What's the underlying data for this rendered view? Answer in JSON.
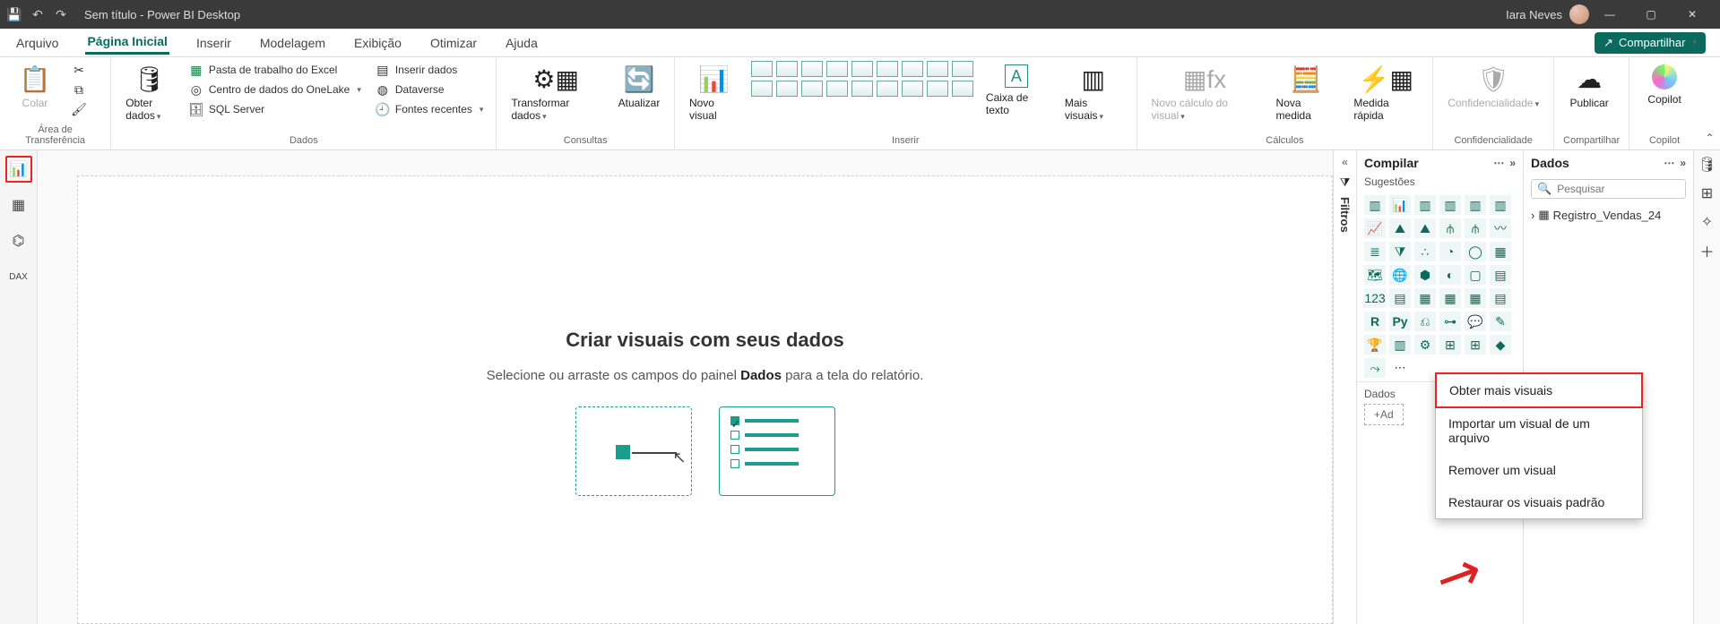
{
  "titlebar": {
    "title": "Sem título - Power BI Desktop",
    "user": "Iara Neves"
  },
  "menu": {
    "tabs": [
      "Arquivo",
      "Página Inicial",
      "Inserir",
      "Modelagem",
      "Exibição",
      "Otimizar",
      "Ajuda"
    ],
    "active": 1,
    "share": "Compartilhar"
  },
  "ribbon": {
    "clipboard": {
      "paste": "Colar",
      "group": "Área de Transferência"
    },
    "data": {
      "get": "Obter dados",
      "excel": "Pasta de trabalho do Excel",
      "onelake": "Centro de dados do OneLake",
      "sql": "SQL Server",
      "enter": "Inserir dados",
      "dataverse": "Dataverse",
      "recent": "Fontes recentes",
      "group": "Dados"
    },
    "queries": {
      "transform": "Transformar dados",
      "refresh": "Atualizar",
      "group": "Consultas"
    },
    "insert": {
      "newvis": "Novo visual",
      "textbox": "Caixa de texto",
      "more": "Mais visuais",
      "group": "Inserir"
    },
    "calc": {
      "newcalc": "Novo cálculo do visual",
      "newmeasure": "Nova medida",
      "quick": "Medida rápida",
      "group": "Cálculos"
    },
    "sens": {
      "label": "Confidencialidade",
      "group": "Confidencialidade"
    },
    "share": {
      "publish": "Publicar",
      "group": "Compartilhar"
    },
    "copilot": {
      "label": "Copilot",
      "group": "Copilot"
    }
  },
  "canvas": {
    "heading": "Criar visuais com seus dados",
    "sub_pre": "Selecione ou arraste os campos do painel ",
    "sub_bold": "Dados",
    "sub_post": " para a tela do relatório."
  },
  "filters": {
    "title": "Filtros"
  },
  "build": {
    "title": "Compilar",
    "sub": "Sugestões",
    "dataSection": "Dados",
    "add": "+Ad",
    "context": {
      "getmore": "Obter mais visuais",
      "import": "Importar um visual de um arquivo",
      "remove": "Remover um visual",
      "restore": "Restaurar os visuais padrão"
    }
  },
  "dataPane": {
    "title": "Dados",
    "searchPlaceholder": "Pesquisar",
    "table": "Registro_Vendas_24"
  }
}
